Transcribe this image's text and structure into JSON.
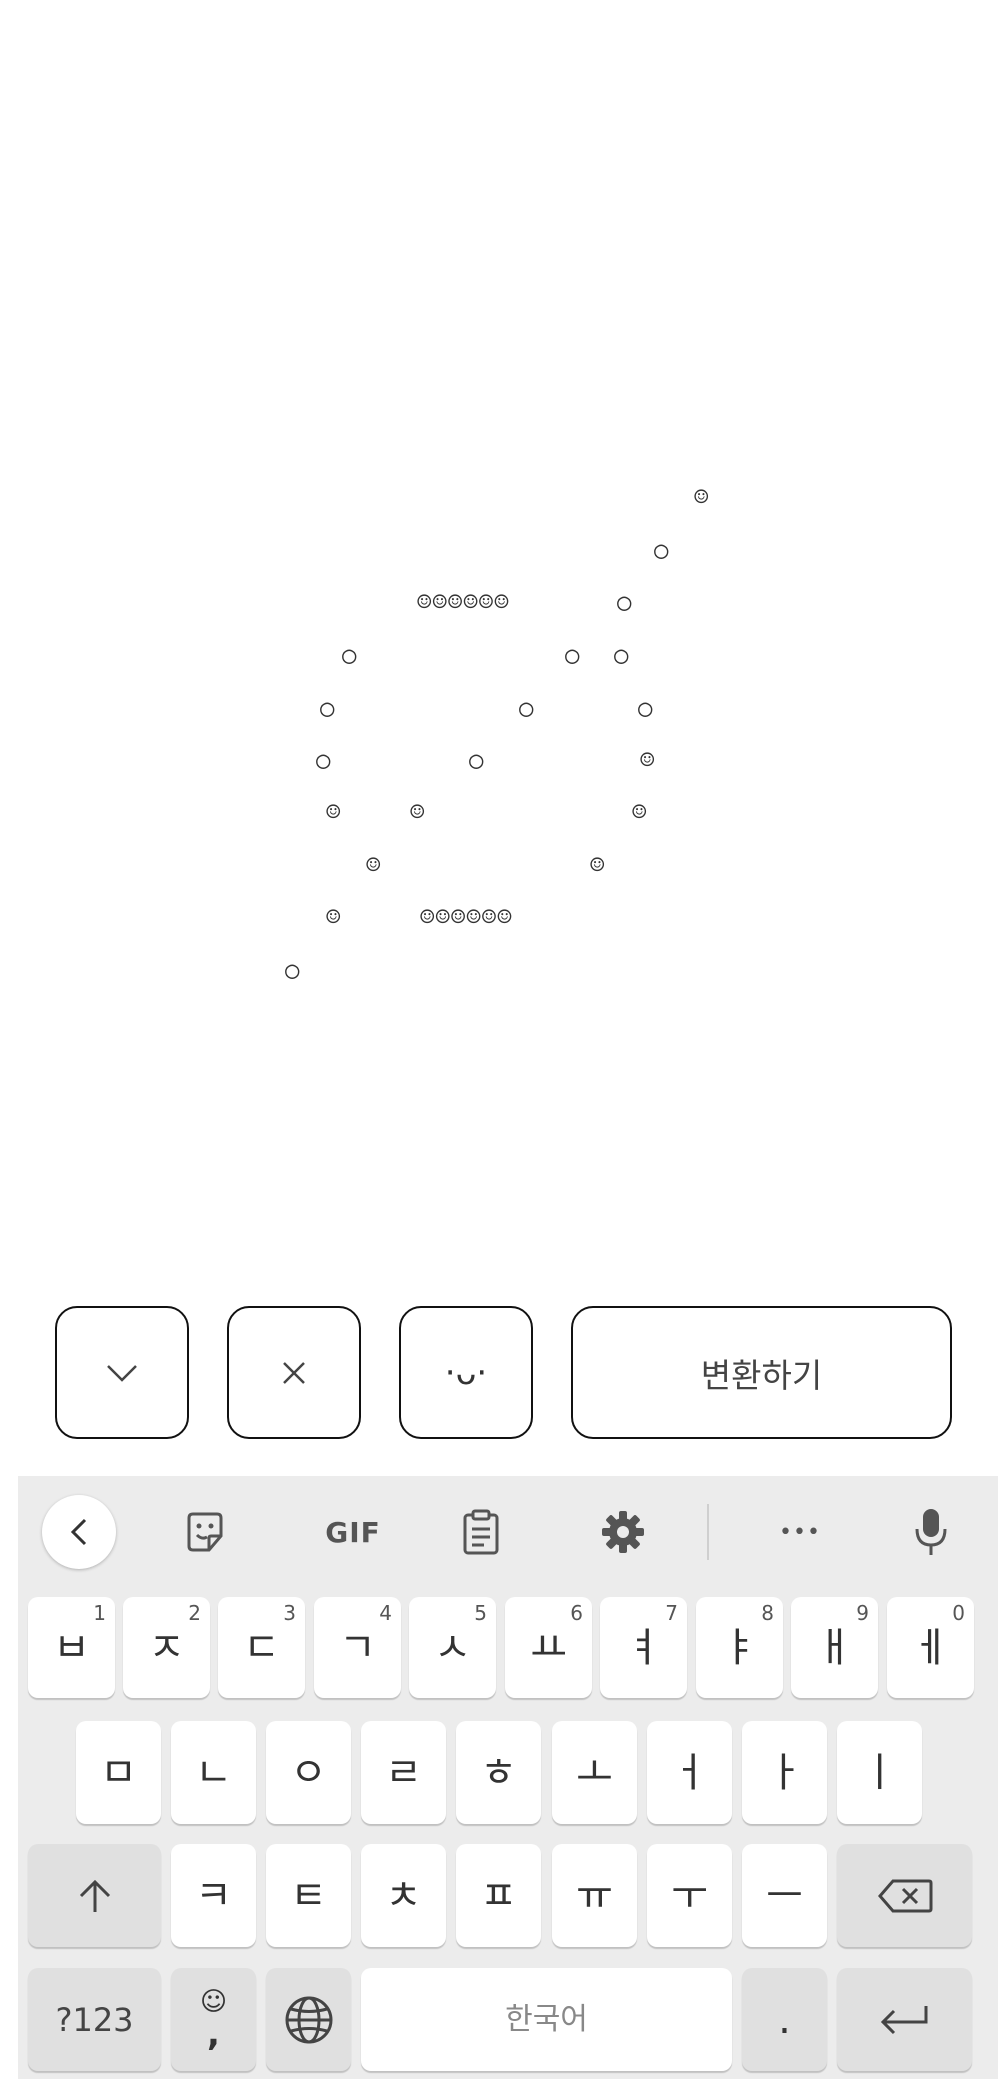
{
  "art": {
    "lines": [
      {
        "text": "☺"
      },
      {
        "text": "○"
      },
      {
        "text": "☺☺☺☺☺☺"
      },
      {
        "text": "○"
      },
      {
        "text": "○"
      },
      {
        "text": "○"
      },
      {
        "text": "○"
      },
      {
        "text": "○"
      },
      {
        "text": "○"
      },
      {
        "text": "○"
      },
      {
        "text": "○"
      },
      {
        "text": "○"
      },
      {
        "text": "○"
      },
      {
        "text": "☺"
      },
      {
        "text": "☺"
      },
      {
        "text": "☺"
      },
      {
        "text": "☺"
      },
      {
        "text": "☺"
      },
      {
        "text": "☺"
      },
      {
        "text": "☺☺☺☺☺☺"
      },
      {
        "text": "○"
      }
    ]
  },
  "actions": {
    "collapse_icon": "chevron-down-icon",
    "collapse_glyph": "⌵",
    "clear_icon": "close-icon",
    "clear_glyph": "×",
    "emoticon_label": "·ᴗ·",
    "convert_label": "변환하기"
  },
  "keyboard": {
    "toolbar": {
      "back_glyph": "‹",
      "gif_label": "GIF",
      "more_glyph": "•••"
    },
    "row1": [
      {
        "label": "ㅂ",
        "hint": "1"
      },
      {
        "label": "ㅈ",
        "hint": "2"
      },
      {
        "label": "ㄷ",
        "hint": "3"
      },
      {
        "label": "ㄱ",
        "hint": "4"
      },
      {
        "label": "ㅅ",
        "hint": "5"
      },
      {
        "label": "ㅛ",
        "hint": "6"
      },
      {
        "label": "ㅕ",
        "hint": "7"
      },
      {
        "label": "ㅑ",
        "hint": "8"
      },
      {
        "label": "ㅐ",
        "hint": "9"
      },
      {
        "label": "ㅔ",
        "hint": "0"
      }
    ],
    "row2": [
      "ㅁ",
      "ㄴ",
      "ㅇ",
      "ㄹ",
      "ㅎ",
      "ㅗ",
      "ㅓ",
      "ㅏ",
      "ㅣ"
    ],
    "row3": [
      "ㅋ",
      "ㅌ",
      "ㅊ",
      "ㅍ",
      "ㅠ",
      "ㅜ",
      "ㅡ"
    ],
    "symbols_label": "?123",
    "comma_emoji": "☺",
    "comma_label": ",",
    "space_label": "한국어",
    "period_label": "."
  }
}
